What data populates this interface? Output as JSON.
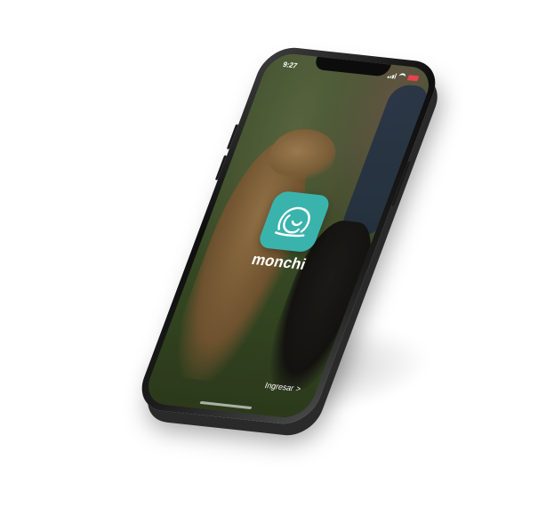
{
  "status_bar": {
    "time": "9:27",
    "battery_color": "#e4434d"
  },
  "app": {
    "brand_name": "monchi",
    "icon": "dog-face-icon",
    "icon_bg_color": "#3bb3ad"
  },
  "actions": {
    "login_label": "Ingresar",
    "login_chevron": ">"
  }
}
